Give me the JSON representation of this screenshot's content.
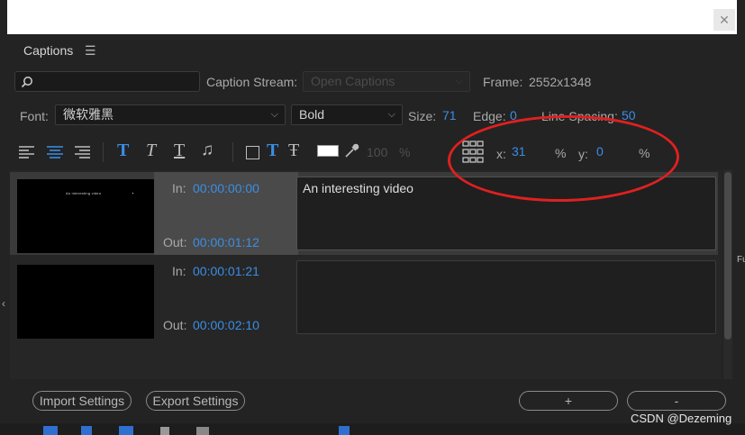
{
  "panel": {
    "title": "Caption Stream"
  },
  "header": {
    "title": "Captions",
    "menu_icon": "hamburger-menu-icon"
  },
  "search": {
    "value": "",
    "placeholder": ""
  },
  "stream": {
    "label": "Caption Stream:",
    "value": "Open Captions"
  },
  "frame": {
    "label": "Frame:",
    "value": "2552x1348"
  },
  "font": {
    "label": "Font:",
    "family": "微软雅黑",
    "style": "Bold"
  },
  "size": {
    "label": "Size:",
    "value": "71"
  },
  "edge": {
    "label": "Edge:",
    "value": "0"
  },
  "line_spacing": {
    "label": "Line Spacing:",
    "value": "50"
  },
  "toolbar": {
    "opacity_value": "100",
    "opacity_unit": "%",
    "x_label": "x:",
    "x_value": "31",
    "x_unit": "%",
    "y_label": "y:",
    "y_value": "0",
    "y_unit": "%",
    "text_color": "#ffffff"
  },
  "captions": [
    {
      "in_label": "In:",
      "in": "00:00:00:00",
      "out_label": "Out:",
      "out": "00:00:01:12",
      "text": "An interesting video",
      "thumb_text": "An interesting video",
      "selected": true
    },
    {
      "in_label": "In:",
      "in": "00:00:01:21",
      "out_label": "Out:",
      "out": "00:00:02:10",
      "text": "",
      "thumb_text": "",
      "selected": false
    }
  ],
  "footer": {
    "import_label": "Import Settings",
    "export_label": "Export Settings",
    "add_label": "+",
    "remove_label": "-"
  },
  "watermark": "CSDN @Dezeming",
  "colors": {
    "accent": "#3a8ee6",
    "annotation": "#e02020",
    "panel_bg": "#232323"
  }
}
